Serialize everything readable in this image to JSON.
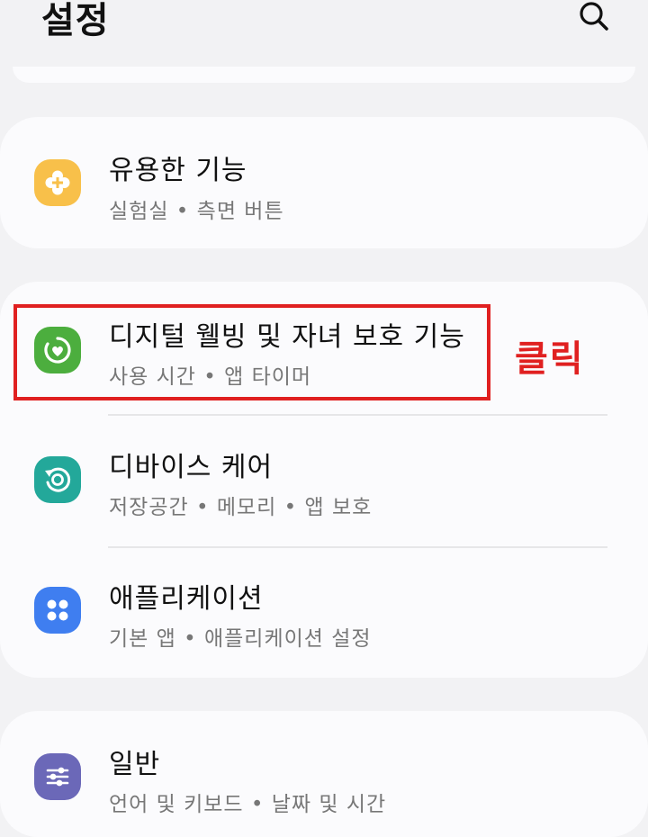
{
  "header": {
    "title": "설정",
    "search_icon": "search-icon"
  },
  "annotation": {
    "label": "클릭",
    "color": "#e02020"
  },
  "cards": [
    {
      "items": [
        {
          "title": "유용한 기능",
          "subtitle": "실험실  •  측면 버튼",
          "icon": "puzzle-plus-icon",
          "icon_color": "#f8c04a"
        }
      ]
    },
    {
      "items": [
        {
          "title": "디지털 웰빙 및 자녀 보호 기능",
          "subtitle": "사용 시간  •  앱 타이머",
          "icon": "wellbeing-heart-icon",
          "icon_color": "#4cae3e"
        },
        {
          "title": "디바이스 케어",
          "subtitle": "저장공간  •  메모리  •  앱 보호",
          "icon": "device-care-icon",
          "icon_color": "#23a89a"
        },
        {
          "title": "애플리케이션",
          "subtitle": "기본 앱  •  애플리케이션 설정",
          "icon": "apps-grid-icon",
          "icon_color": "#3f7ef0"
        }
      ]
    },
    {
      "items": [
        {
          "title": "일반",
          "subtitle": "언어 및 키보드  •  날짜 및 시간",
          "icon": "sliders-icon",
          "icon_color": "#6b68b8"
        }
      ]
    }
  ]
}
